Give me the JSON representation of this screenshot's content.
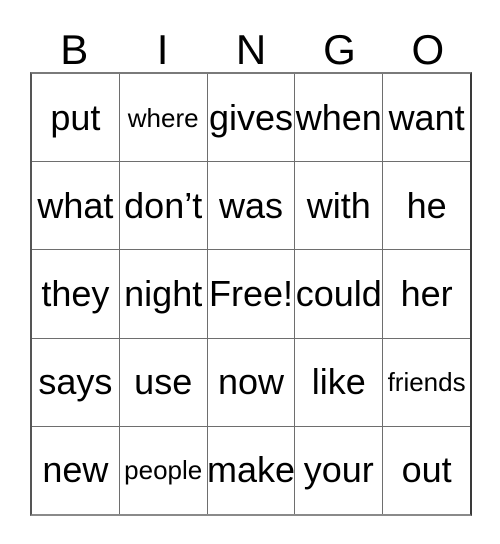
{
  "card": {
    "header_letters": [
      "B",
      "I",
      "N",
      "G",
      "O"
    ],
    "free_space_label": "Free!",
    "grid": [
      [
        "put",
        "where",
        "gives",
        "when",
        "want"
      ],
      [
        "what",
        "don’t",
        "was",
        "with",
        "he"
      ],
      [
        "they",
        "night",
        "Free!",
        "could",
        "her"
      ],
      [
        "says",
        "use",
        "now",
        "like",
        "friends"
      ],
      [
        "new",
        "people",
        "make",
        "your",
        "out"
      ]
    ],
    "colors": {
      "text": "#000000",
      "background": "#ffffff",
      "grid_line": "#6e6e6e",
      "grid_outer": "#555555"
    }
  }
}
